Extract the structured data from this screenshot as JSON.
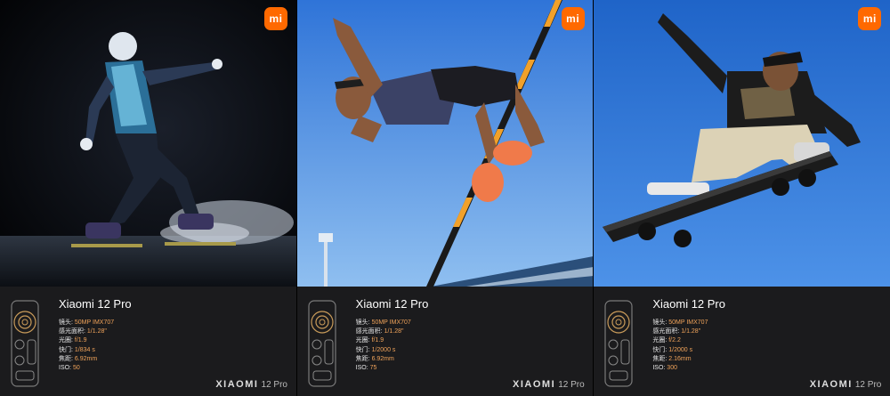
{
  "panels": [
    {
      "model": "Xiaomi 12 Pro",
      "lens_label": "镜头: ",
      "lens_value": "50MP IMX707",
      "sensor_label": "感光面积: ",
      "sensor_value": "1/1.28\"",
      "aperture_label": "光圈: ",
      "aperture_value": "f/1.9",
      "shutter_label": "快门: ",
      "shutter_value": "1/834 s",
      "focal_label": "焦距: ",
      "focal_value": "6.92mm",
      "iso_label": "ISO: ",
      "iso_value": "50",
      "brand_word": "XIAOMI",
      "brand_model": "12 Pro",
      "logo": "mi"
    },
    {
      "model": "Xiaomi 12 Pro",
      "lens_label": "镜头: ",
      "lens_value": "50MP IMX707",
      "sensor_label": "感光面积: ",
      "sensor_value": "1/1.28\"",
      "aperture_label": "光圈: ",
      "aperture_value": "f/1.9",
      "shutter_label": "快门: ",
      "shutter_value": "1/2000 s",
      "focal_label": "焦距: ",
      "focal_value": "6.92mm",
      "iso_label": "ISO: ",
      "iso_value": "75",
      "brand_word": "XIAOMI",
      "brand_model": "12 Pro",
      "logo": "mi"
    },
    {
      "model": "Xiaomi 12 Pro",
      "lens_label": "镜头: ",
      "lens_value": "50MP IMX707",
      "sensor_label": "感光面积: ",
      "sensor_value": "1/1.28\"",
      "aperture_label": "光圈: ",
      "aperture_value": "f/2.2",
      "shutter_label": "快门: ",
      "shutter_value": "1/2000 s",
      "focal_label": "焦距: ",
      "focal_value": "2.16mm",
      "iso_label": "ISO: ",
      "iso_value": "300",
      "brand_word": "XIAOMI",
      "brand_model": "12 Pro",
      "logo": "mi"
    }
  ],
  "colors": {
    "accent": "#ff6900",
    "value": "#f0a35a",
    "info_bg": "#1b1b1d",
    "sky": "#4a8fe6"
  }
}
